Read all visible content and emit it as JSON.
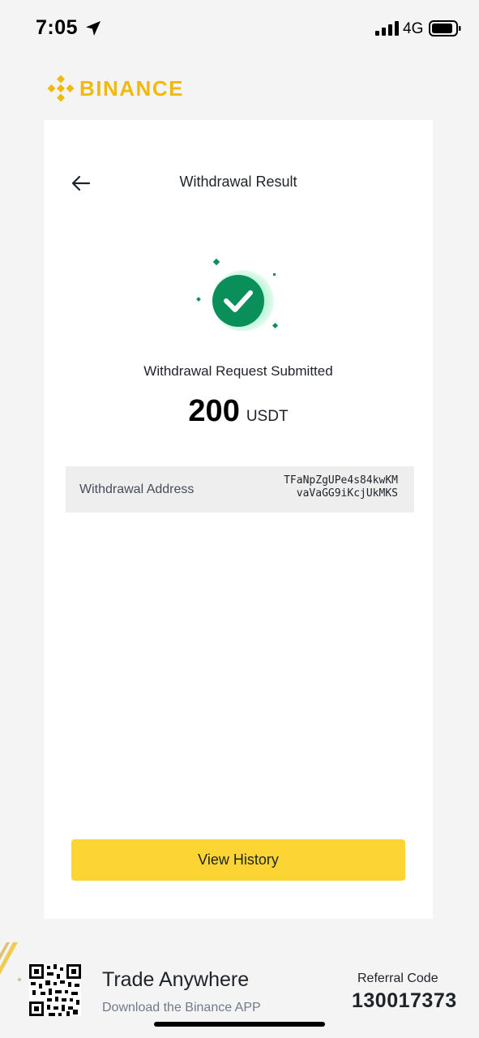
{
  "status_bar": {
    "time": "7:05",
    "network": "4G",
    "icons": [
      "location-arrow-icon",
      "signal-bars-icon",
      "battery-icon"
    ]
  },
  "brand": {
    "name": "BINANCE",
    "color": "#F0B90B"
  },
  "header": {
    "title": "Withdrawal Result",
    "back_icon": "back-arrow-icon"
  },
  "result": {
    "icon": "success-check-icon",
    "message": "Withdrawal Request Submitted",
    "amount": "200",
    "currency": "USDT"
  },
  "address": {
    "label": "Withdrawal Address",
    "line1": "TFaNpZgUPe4s84kwKM",
    "line2": "vaVaGG9iKcjUkMKS"
  },
  "actions": {
    "view_history": "View History",
    "button_color": "#FCD535"
  },
  "footer": {
    "title": "Trade Anywhere",
    "subtitle": "Download the Binance APP",
    "referral_label": "Referral Code",
    "referral_code": "130017373",
    "qr_icon": "qr-code-icon"
  },
  "colors": {
    "success": "#0ECB81",
    "success_dark": "#0B8F5A",
    "accent": "#FCD535"
  }
}
